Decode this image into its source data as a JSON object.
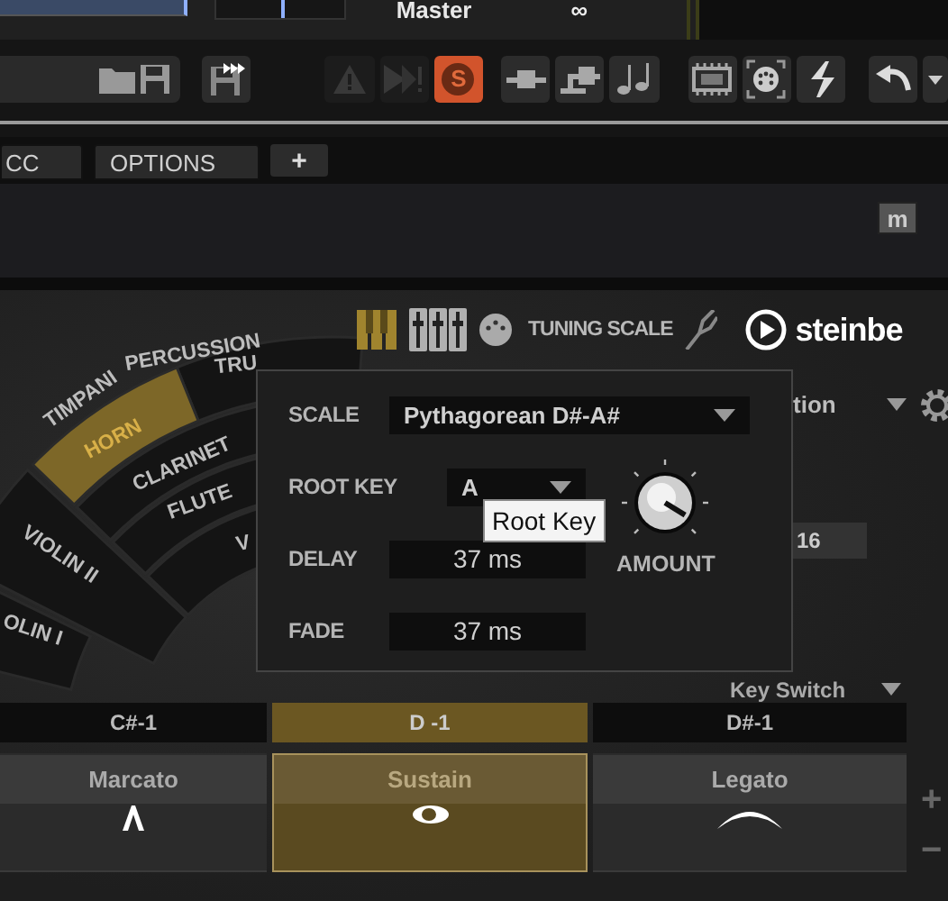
{
  "top_strip": {
    "track_name": "Master",
    "loop_symbol": "∞"
  },
  "toolbar": {
    "buttons": [
      {
        "kind": "save_all",
        "on": false,
        "disabled": false
      },
      {
        "kind": "warning",
        "on": false,
        "disabled": true
      },
      {
        "kind": "midi_warning",
        "on": false,
        "disabled": true
      },
      {
        "kind": "solo",
        "label": "S",
        "on": true,
        "disabled": false
      },
      {
        "kind": "connector",
        "on": false,
        "disabled": false
      },
      {
        "kind": "routing",
        "on": false,
        "disabled": false
      },
      {
        "kind": "notes",
        "on": false,
        "disabled": false
      },
      {
        "kind": "memory",
        "on": false,
        "disabled": false
      },
      {
        "kind": "midi_port",
        "on": false,
        "disabled": false
      },
      {
        "kind": "lightning",
        "on": false,
        "disabled": false
      },
      {
        "kind": "undo",
        "on": false,
        "disabled": false
      }
    ]
  },
  "tabs": [
    {
      "label": "CC",
      "selected": false
    },
    {
      "label": "OPTIONS",
      "selected": false
    }
  ],
  "add_tab": "+",
  "mode_button": "m",
  "header": {
    "section_label": "TUNING SCALE",
    "brand": "steinbe"
  },
  "instruments": [
    {
      "label": "TIMPANI",
      "selected": false
    },
    {
      "label": "PERCUSSION",
      "selected": false
    },
    {
      "label": "TRU",
      "selected": false
    },
    {
      "label": "HORN",
      "selected": true
    },
    {
      "label": "CLARINET",
      "selected": false
    },
    {
      "label": "FLUTE",
      "selected": false
    },
    {
      "label": "V",
      "selected": false
    },
    {
      "label": "VIOLIN II",
      "selected": false
    },
    {
      "label": "OLIN I",
      "selected": false
    }
  ],
  "background_panel": {
    "partial_label": "tion",
    "value": "16",
    "key_switch_label": "Key Switch"
  },
  "tuning_popup": {
    "scale_label": "SCALE",
    "scale_value": "Pythagorean D#-A#",
    "root_key_label": "ROOT KEY",
    "root_key_value": "A",
    "delay_label": "DELAY",
    "delay_value": "37 ms",
    "fade_label": "FADE",
    "fade_value": "37 ms",
    "amount_label": "AMOUNT",
    "amount": {
      "level": 0.95
    }
  },
  "tooltip": "Root Key",
  "keys": [
    {
      "label": "C#-1",
      "selected": false
    },
    {
      "label": "D -1",
      "selected": true
    },
    {
      "label": "D#-1",
      "selected": false
    }
  ],
  "articulations": [
    {
      "label": "Marcato",
      "kind": "marcato",
      "selected": false
    },
    {
      "label": "Sustain",
      "kind": "sustain",
      "selected": true
    },
    {
      "label": "Legato",
      "kind": "legato",
      "selected": false
    }
  ],
  "side_controls": [
    "+",
    "−"
  ]
}
